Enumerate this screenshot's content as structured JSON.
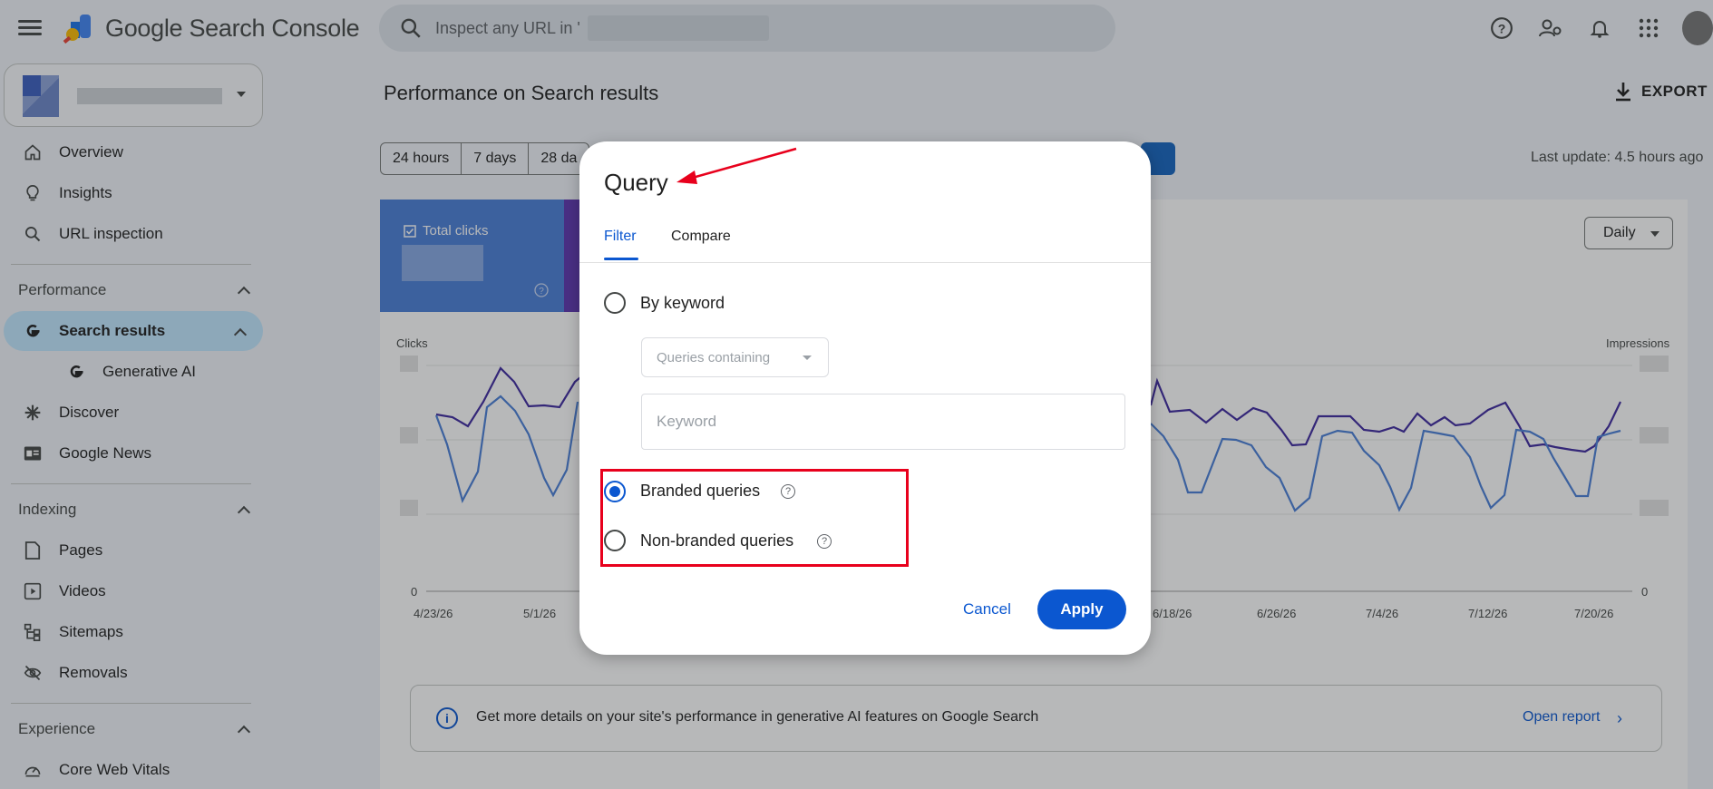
{
  "app": {
    "name": "Google Search Console"
  },
  "search": {
    "placeholder": "Inspect any URL in '"
  },
  "sidebar": {
    "items_top": [
      {
        "label": "Overview",
        "icon": "home-icon"
      },
      {
        "label": "Insights",
        "icon": "lightbulb-icon"
      },
      {
        "label": "URL inspection",
        "icon": "search-icon"
      }
    ],
    "performance": {
      "heading": "Performance",
      "items": [
        {
          "label": "Search results",
          "icon": "google-g-icon",
          "active": true
        },
        {
          "label": "Generative AI",
          "icon": "google-g-icon"
        },
        {
          "label": "Discover",
          "icon": "asterisk-icon"
        },
        {
          "label": "Google News",
          "icon": "news-icon"
        }
      ]
    },
    "indexing": {
      "heading": "Indexing",
      "items": [
        {
          "label": "Pages",
          "icon": "page-icon"
        },
        {
          "label": "Videos",
          "icon": "video-icon"
        },
        {
          "label": "Sitemaps",
          "icon": "sitemap-icon"
        },
        {
          "label": "Removals",
          "icon": "eye-off-icon"
        }
      ]
    },
    "experience": {
      "heading": "Experience",
      "items": [
        {
          "label": "Core Web Vitals",
          "icon": "gauge-icon"
        }
      ]
    }
  },
  "main": {
    "title": "Performance on Search results",
    "export_label": "EXPORT",
    "ranges": [
      "24 hours",
      "7 days",
      "28 da"
    ],
    "last_update": "Last update: 4.5 hours ago",
    "metric_clicks_label": "Total clicks",
    "granularity": "Daily",
    "chart": {
      "left_axis_label": "Clicks",
      "right_axis_label": "Impressions",
      "zero_left": "0",
      "zero_right": "0",
      "left_dates": [
        "4/23/26",
        "5/1/26"
      ],
      "right_dates": [
        "6/18/26",
        "6/26/26",
        "7/4/26",
        "7/12/26",
        "7/20/26"
      ]
    },
    "banner": {
      "text": "Get more details on your site's performance in generative AI features on Google Search",
      "link": "Open report"
    }
  },
  "dialog": {
    "title": "Query",
    "tabs": [
      "Filter",
      "Compare"
    ],
    "by_keyword_label": "By keyword",
    "match_type": "Queries containing",
    "keyword_placeholder": "Keyword",
    "branded_label": "Branded queries",
    "non_branded_label": "Non-branded queries",
    "selected_option": "Branded queries",
    "cancel_label": "Cancel",
    "apply_label": "Apply"
  },
  "colors": {
    "accent": "#0b57d0",
    "clicks_series": "#4a7fd8",
    "impressions_series": "#5e35b1",
    "annotation": "#e8001c"
  }
}
